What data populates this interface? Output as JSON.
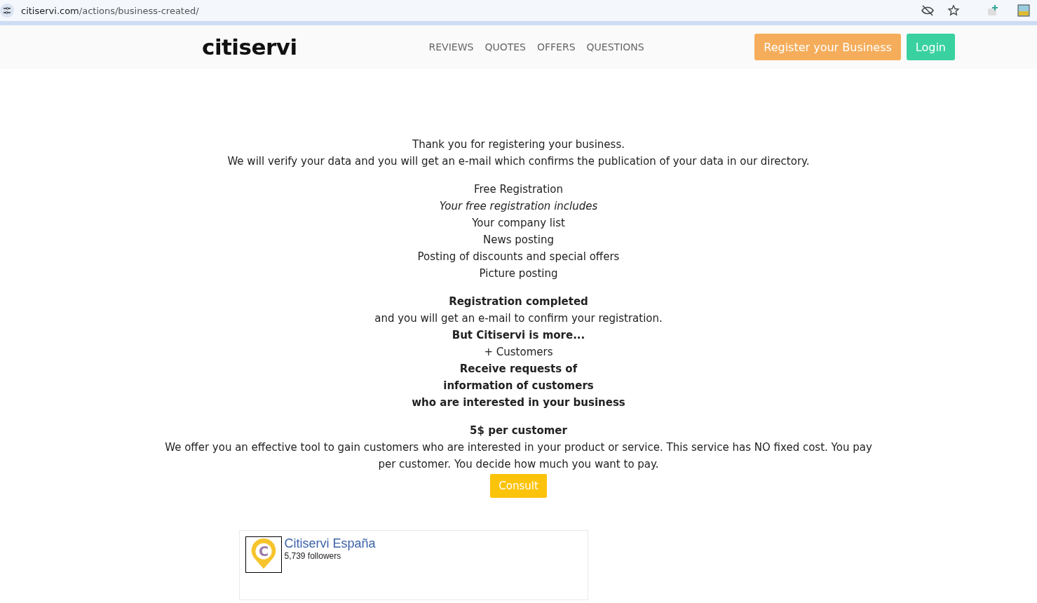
{
  "browser": {
    "url_host": "citiservi.com",
    "url_path": "/actions/business-created/"
  },
  "header": {
    "logo": "citiservi",
    "nav": [
      "REVIEWS",
      "QUOTES",
      "OFFERS",
      "QUESTIONS"
    ],
    "register_button": "Register your Business",
    "login_button": "Login"
  },
  "content": {
    "blocks": [
      {
        "lines": [
          {
            "kind": "plain",
            "text": "Thank you for registering your business."
          },
          {
            "kind": "plain",
            "text": "We will verify your data and you will get an e-mail which confirms the publication of your data in our directory."
          }
        ]
      },
      {
        "lines": [
          {
            "kind": "plain",
            "text": "Free Registration"
          },
          {
            "kind": "italic",
            "text": "Your free registration includes"
          },
          {
            "kind": "plain",
            "text": "Your company list"
          },
          {
            "kind": "plain",
            "text": "News posting"
          },
          {
            "kind": "plain",
            "text": "Posting of discounts and special offers"
          },
          {
            "kind": "plain",
            "text": "Picture posting"
          }
        ]
      },
      {
        "lines": [
          {
            "kind": "bold",
            "text": "Registration completed"
          },
          {
            "kind": "plain",
            "text": "and you will get an e-mail to confirm your registration."
          },
          {
            "kind": "bold",
            "text": "But Citiservi is more..."
          },
          {
            "kind": "plain",
            "text": "+ Customers"
          },
          {
            "kind": "bold",
            "text": "Receive requests of"
          },
          {
            "kind": "bold",
            "text": "information of customers"
          },
          {
            "kind": "bold",
            "text": "who are interested in your business"
          }
        ]
      },
      {
        "lines": [
          {
            "kind": "bold",
            "text": "5$ per customer"
          },
          {
            "kind": "plain",
            "text": "We offer you an effective tool to gain customers who are interested in your product or service. This service has NO fixed cost. You pay per customer. You decide how much you want to pay."
          }
        ]
      }
    ],
    "consult_button": "Consult"
  },
  "facebook_card": {
    "logo_letter": "C",
    "name": "Citiservi España",
    "followers": "5,739 followers"
  }
}
